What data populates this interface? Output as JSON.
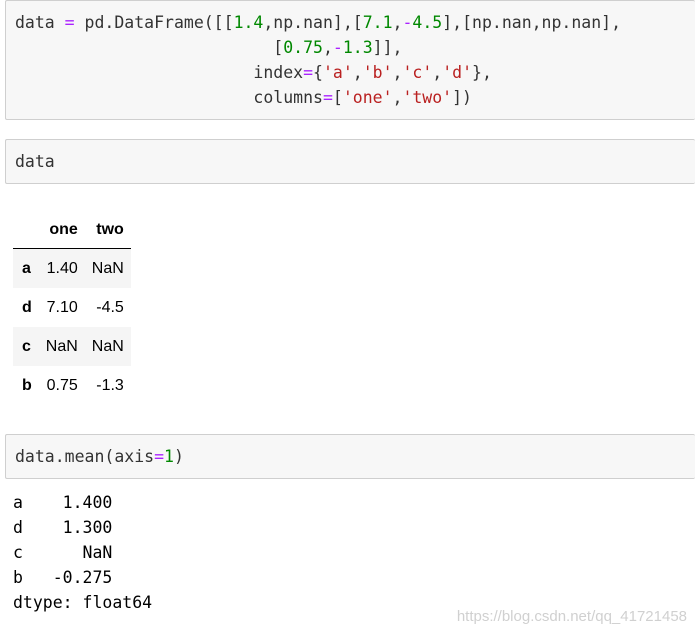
{
  "cell1": {
    "line1": {
      "a": "data ",
      "b": "=",
      "c": " pd.DataFrame([[",
      "d": "1.4",
      "e": ",np.nan],[",
      "f": "7.1",
      "g": ",",
      "h": "-",
      "i": "4.5",
      "j": "],[np.nan,np.nan],"
    },
    "line2": {
      "a": "                          [",
      "b": "0.75",
      "c": ",",
      "d": "-",
      "e": "1.3",
      "f": "]],"
    },
    "line3": {
      "a": "                        index",
      "b": "=",
      "c": "{",
      "d": "'a'",
      "e": ",",
      "f": "'b'",
      "g": ",",
      "h": "'c'",
      "i": ",",
      "j": "'d'",
      "k": "},"
    },
    "line4": {
      "a": "                        columns",
      "b": "=",
      "c": "[",
      "d": "'one'",
      "e": ",",
      "f": "'two'",
      "g": "])"
    }
  },
  "cell2": {
    "code": "data"
  },
  "dataframe": {
    "columns": [
      "one",
      "two"
    ],
    "rows": [
      {
        "index": "a",
        "one": "1.40",
        "two": "NaN"
      },
      {
        "index": "d",
        "one": "7.10",
        "two": "-4.5"
      },
      {
        "index": "c",
        "one": "NaN",
        "two": "NaN"
      },
      {
        "index": "b",
        "one": "0.75",
        "two": "-1.3"
      }
    ]
  },
  "cell3": {
    "a": "data.mean(axis",
    "b": "=",
    "c": "1",
    "d": ")"
  },
  "output": {
    "lines": [
      "a    1.400",
      "d    1.300",
      "c      NaN",
      "b   -0.275",
      "dtype: float64"
    ]
  },
  "watermark": "https://blog.csdn.net/qq_41721458"
}
